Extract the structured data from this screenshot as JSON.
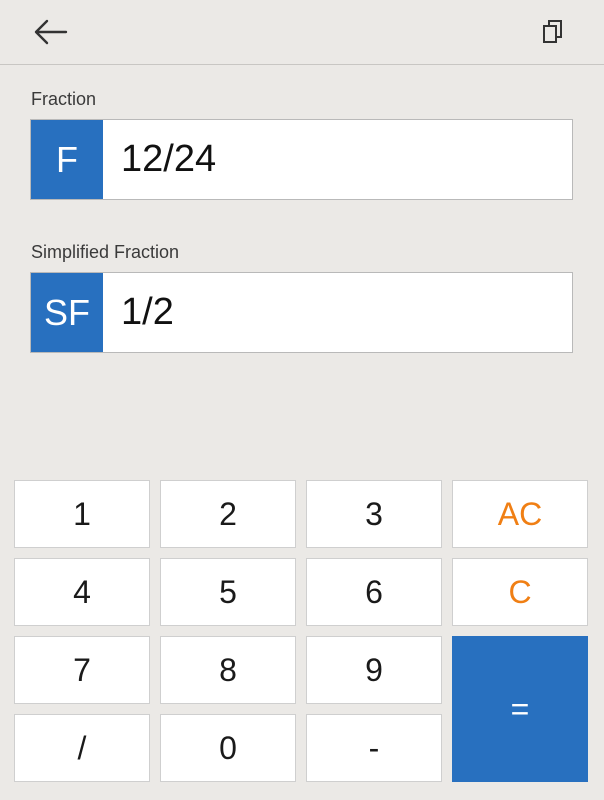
{
  "header": {
    "back_icon": "arrow-left-icon",
    "copy_icon": "copy-icon"
  },
  "fraction": {
    "label": "Fraction",
    "badge": "F",
    "value": "12/24"
  },
  "simplified": {
    "label": "Simplified Fraction",
    "badge": "SF",
    "value": "1/2"
  },
  "keypad": {
    "k1": "1",
    "k2": "2",
    "k3": "3",
    "ac": "AC",
    "k4": "4",
    "k5": "5",
    "k6": "6",
    "c": "C",
    "k7": "7",
    "k8": "8",
    "k9": "9",
    "equals": "=",
    "slash": "/",
    "k0": "0",
    "minus": "-"
  },
  "colors": {
    "accent_blue": "#2870bf",
    "accent_orange": "#f07f14",
    "background": "#ebe9e6"
  }
}
